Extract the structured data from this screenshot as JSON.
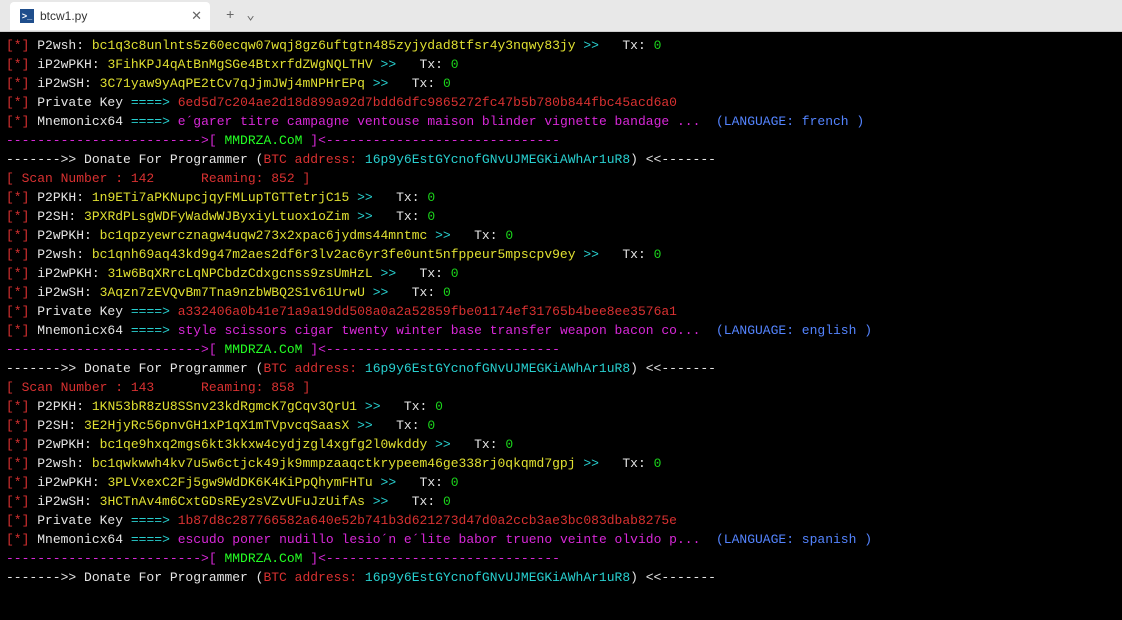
{
  "tab": {
    "title": "btcw1.py",
    "icon": ">_"
  },
  "prefix": {
    "star": "[*]",
    "arrow": "====>",
    "gtgt": ">>",
    "tx": "Tx:"
  },
  "labels": {
    "p2wsh": "P2wsh:",
    "ip2wpkh": "iP2wPKH:",
    "ip2wsh": "iP2wSH:",
    "private_key": "Private Key",
    "mnemonicx64": "Mnemonicx64",
    "p2pkh": "P2PKH:",
    "p2sh": "P2SH:",
    "p2wpkh": "P2wPKH:",
    "language": "LANGUAGE:",
    "scan_number": "Scan Number :",
    "reaming": "Reaming:",
    "donate": "Donate For Programmer (",
    "btc_address": "BTC address:",
    "donate_close": ")",
    "lt": "<<",
    "gt": ">>",
    "mmdrza": "MMDRZA.CoM"
  },
  "dash7": "-------",
  "dash_sep_left": "------------------------->[",
  "dash_sep_right": "]<------------------------------",
  "langs": {
    "french": "french",
    "english": "english",
    "spanish": "spanish"
  },
  "donate_addr": "16p9y6EstGYcnofGNvUJMEGKiAWhAr1uR8",
  "zero": "0",
  "blocks": [
    {
      "rows": [
        {
          "label": "p2wsh",
          "addr": "bc1q3c8unlnts5z60ecqw07wqj8gz6uftgtn485zyjydad8tfsr4y3nqwy83jy"
        },
        {
          "label": "ip2wpkh",
          "addr": "3FihKPJ4qAtBnMgSGe4BtxrfdZWgNQLTHV"
        },
        {
          "label": "ip2wsh",
          "addr": "3C71yaw9yAqPE2tCv7qJjmJWj4mNPHrEPq"
        }
      ],
      "private_key": "6ed5d7c204ae2d18d899a92d7bdd6dfc9865272fc47b5b780b844fbc45acd6a0",
      "mnemonic": "e´garer titre campagne ventouse maison blinder vignette bandage ...",
      "language": "french"
    },
    {
      "scan": "142",
      "reaming": "852",
      "rows": [
        {
          "label": "p2pkh",
          "addr": "1n9ETi7aPKNupcjqyFMLupTGTTetrjC15"
        },
        {
          "label": "p2sh",
          "addr": "3PXRdPLsgWDFyWadwWJByxiyLtuox1oZim"
        },
        {
          "label": "p2wpkh",
          "addr": "bc1qpzyewrcznagw4uqw273x2xpac6jydms44mntmc"
        },
        {
          "label": "p2wsh",
          "addr": "bc1qnh69aq43kd9g47m2aes2df6r3lv2ac6yr3fe0unt5nfppeur5mpscpv9ey"
        },
        {
          "label": "ip2wpkh",
          "addr": "31w6BqXRrcLqNPCbdzCdxgcnss9zsUmHzL"
        },
        {
          "label": "ip2wsh",
          "addr": "3Aqzn7zEVQvBm7Tna9nzbWBQ2S1v61UrwU"
        }
      ],
      "private_key": "a332406a0b41e71a9a19dd508a0a2a52859fbe01174ef31765b4bee8ee3576a1",
      "mnemonic": "style scissors cigar twenty winter base transfer weapon bacon co...",
      "language": "english"
    },
    {
      "scan": "143",
      "reaming": "858",
      "rows": [
        {
          "label": "p2pkh",
          "addr": "1KN53bR8zU8SSnv23kdRgmcK7gCqv3QrU1"
        },
        {
          "label": "p2sh",
          "addr": "3E2HjyRc56pnvGH1xP1qX1mTVpvcqSaasX"
        },
        {
          "label": "p2wpkh",
          "addr": "bc1qe9hxq2mgs6kt3kkxw4cydjzgl4xgfg2l0wkddy"
        },
        {
          "label": "p2wsh",
          "addr": "bc1qwkwwh4kv7u5w6ctjck49jk9mmpzaaqctkrypeem46ge338rj0qkqmd7gpj"
        },
        {
          "label": "ip2wpkh",
          "addr": "3PLVxexC2Fj5gw9WdDK6K4KiPpQhymFHTu"
        },
        {
          "label": "ip2wsh",
          "addr": "3HCTnAv4m6CxtGDsREy2sVZvUFuJzUifAs"
        }
      ],
      "private_key": "1b87d8c287766582a640e52b741b3d621273d47d0a2ccb3ae3bc083dbab8275e",
      "mnemonic": "escudo poner nudillo lesio´n e´lite babor trueno veinte olvido p...",
      "language": "spanish"
    }
  ]
}
